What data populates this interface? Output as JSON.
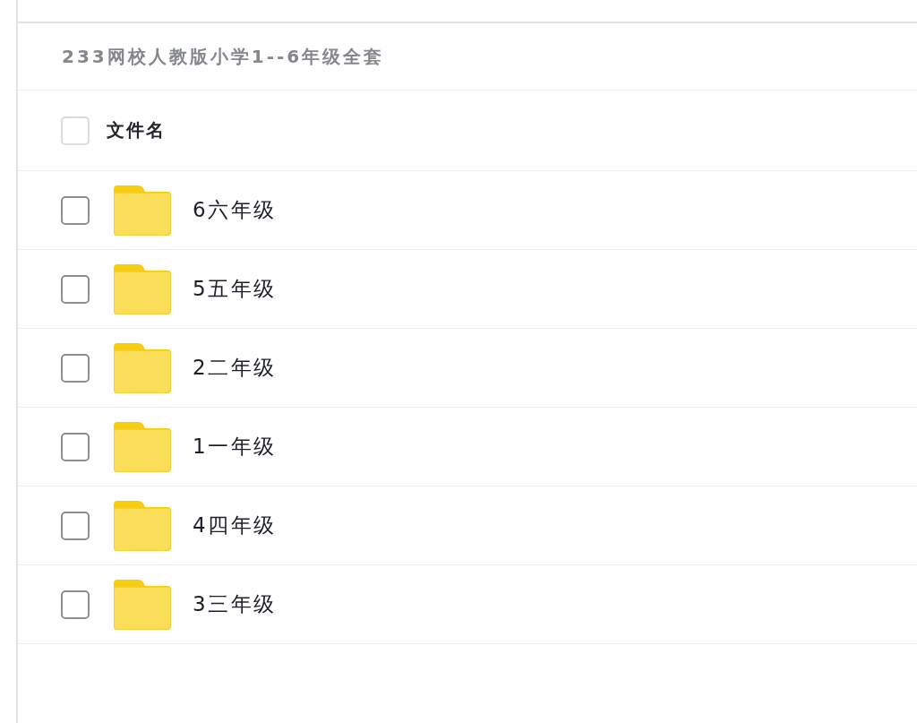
{
  "title": "233网校人教版小学1--6年级全套",
  "table": {
    "select_all": {
      "checked": false
    },
    "columns": [
      {
        "label": "文件名"
      }
    ],
    "rows": [
      {
        "name": "6六年级",
        "checked": false
      },
      {
        "name": "5五年级",
        "checked": false
      },
      {
        "name": "2二年级",
        "checked": false
      },
      {
        "name": "1一年级",
        "checked": false
      },
      {
        "name": "4四年级",
        "checked": false
      },
      {
        "name": "3三年级",
        "checked": false
      }
    ]
  }
}
